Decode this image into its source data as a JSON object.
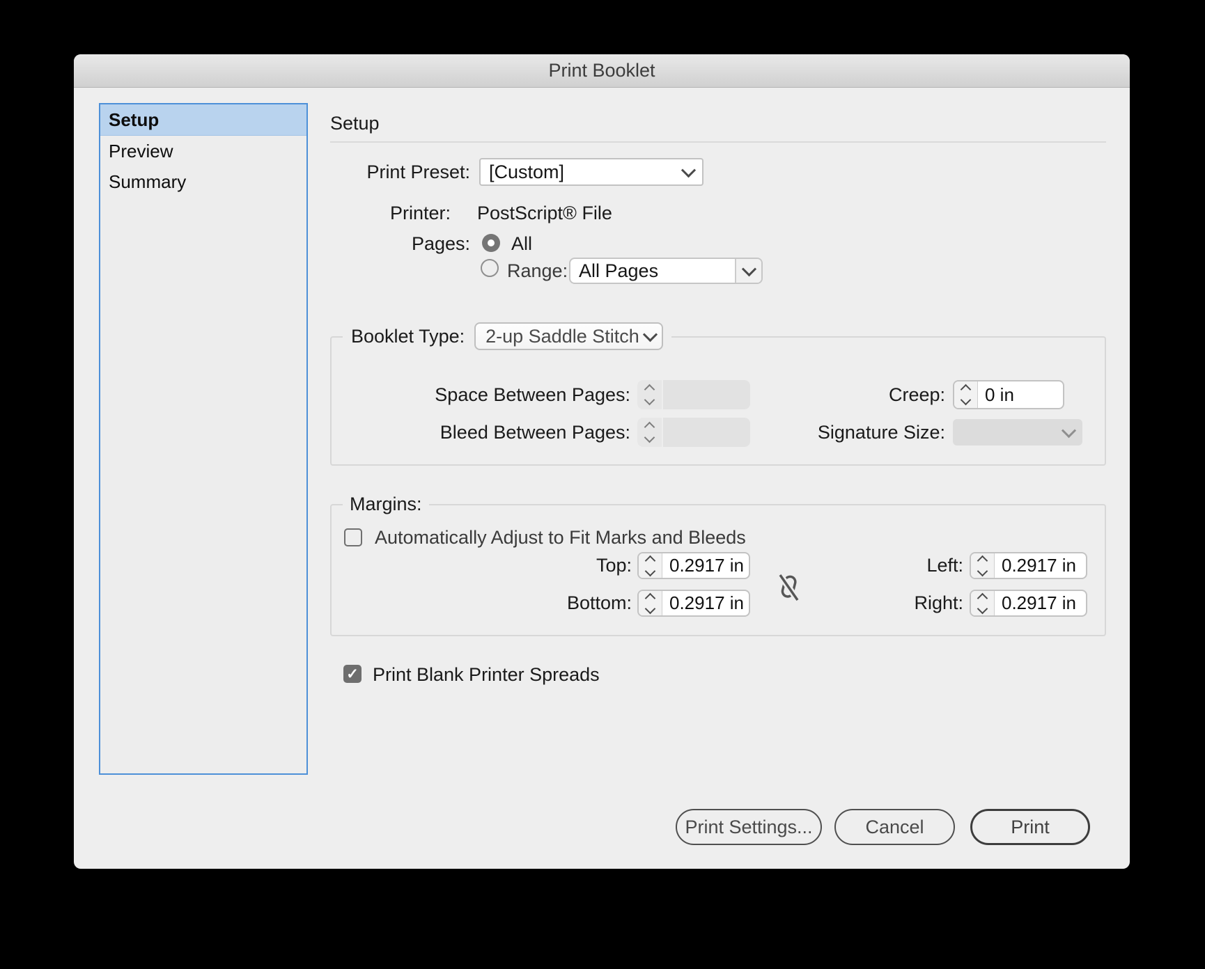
{
  "window": {
    "title": "Print Booklet"
  },
  "sidebar": {
    "items": [
      {
        "label": "Setup",
        "selected": true
      },
      {
        "label": "Preview",
        "selected": false
      },
      {
        "label": "Summary",
        "selected": false
      }
    ]
  },
  "main": {
    "heading": "Setup",
    "print_preset": {
      "label": "Print Preset:",
      "value": "[Custom]"
    },
    "printer": {
      "label": "Printer:",
      "value": "PostScript® File"
    },
    "pages": {
      "label": "Pages:",
      "all_label": "All",
      "all_selected": true,
      "range_label": "Range:",
      "range_selected": false,
      "range_value": "All Pages"
    },
    "booklet": {
      "type_label": "Booklet Type:",
      "type_value": "2-up Saddle Stitch",
      "space_label": "Space Between Pages:",
      "space_value": "",
      "space_disabled": true,
      "bleed_label": "Bleed Between Pages:",
      "bleed_value": "",
      "bleed_disabled": true,
      "creep_label": "Creep:",
      "creep_value": "0 in",
      "signature_label": "Signature Size:",
      "signature_value": "",
      "signature_disabled": true
    },
    "margins": {
      "legend": "Margins:",
      "auto_adjust_label": "Automatically Adjust to Fit Marks and Bleeds",
      "auto_adjust_checked": false,
      "linked": false,
      "top": {
        "label": "Top:",
        "value": "0.2917 in"
      },
      "bottom": {
        "label": "Bottom:",
        "value": "0.2917 in"
      },
      "left": {
        "label": "Left:",
        "value": "0.2917 in"
      },
      "right": {
        "label": "Right:",
        "value": "0.2917 in"
      }
    },
    "print_blank": {
      "label": "Print Blank Printer Spreads",
      "checked": true
    }
  },
  "footer": {
    "buttons": [
      {
        "label": "Print Settings...",
        "default": false
      },
      {
        "label": "Cancel",
        "default": false
      },
      {
        "label": "Print",
        "default": true
      }
    ]
  },
  "colors": {
    "accent_blue": "#4d90d8",
    "selected_row_bg": "#b9d3ee",
    "dialog_bg": "#eeeeee"
  }
}
